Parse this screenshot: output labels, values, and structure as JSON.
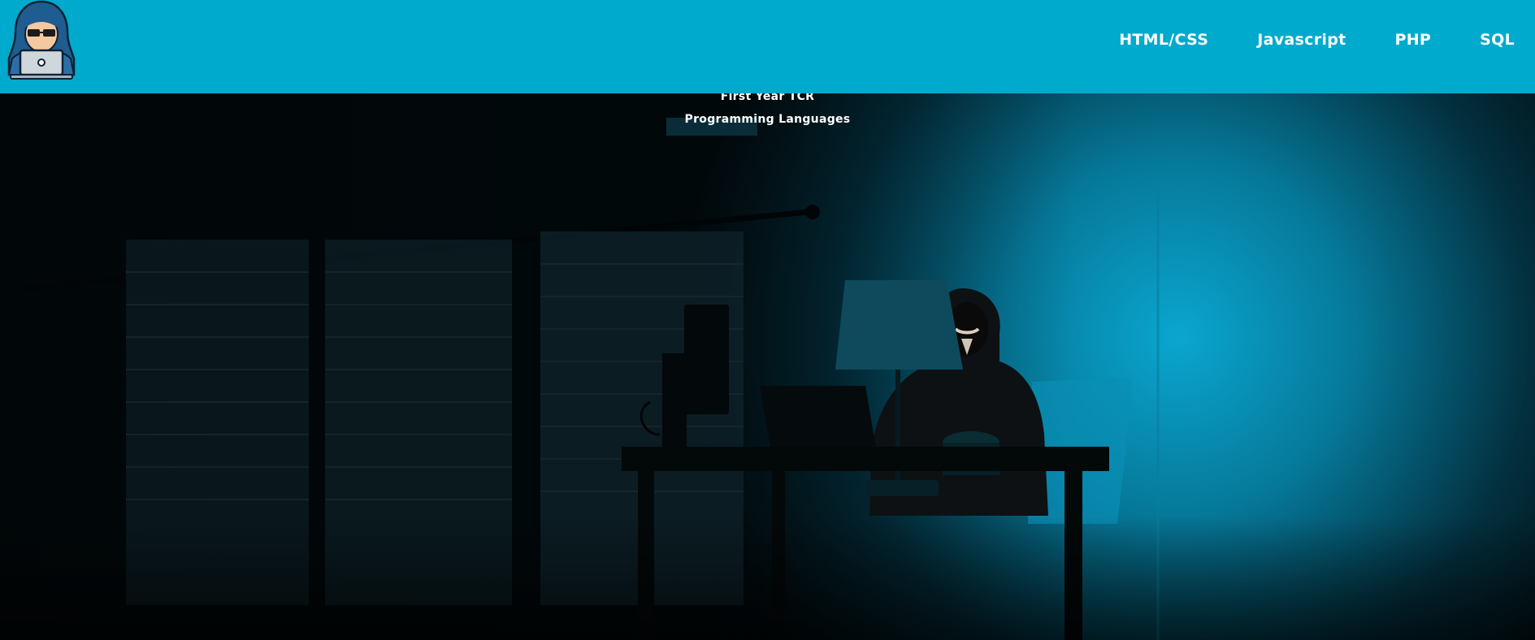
{
  "nav": {
    "links": [
      {
        "label": "HTML/CSS"
      },
      {
        "label": "Javascript"
      },
      {
        "label": "PHP"
      },
      {
        "label": "SQL"
      }
    ]
  },
  "hero": {
    "title": "First Year TCR",
    "subtitle": "Programming Languages",
    "image": "hacker-at-desk-illustration"
  },
  "colors": {
    "navbar_bg": "#00aacc",
    "nav_text": "#ffffff",
    "hero_glow": "#0aa6cf",
    "hero_dark": "#010a0d"
  }
}
